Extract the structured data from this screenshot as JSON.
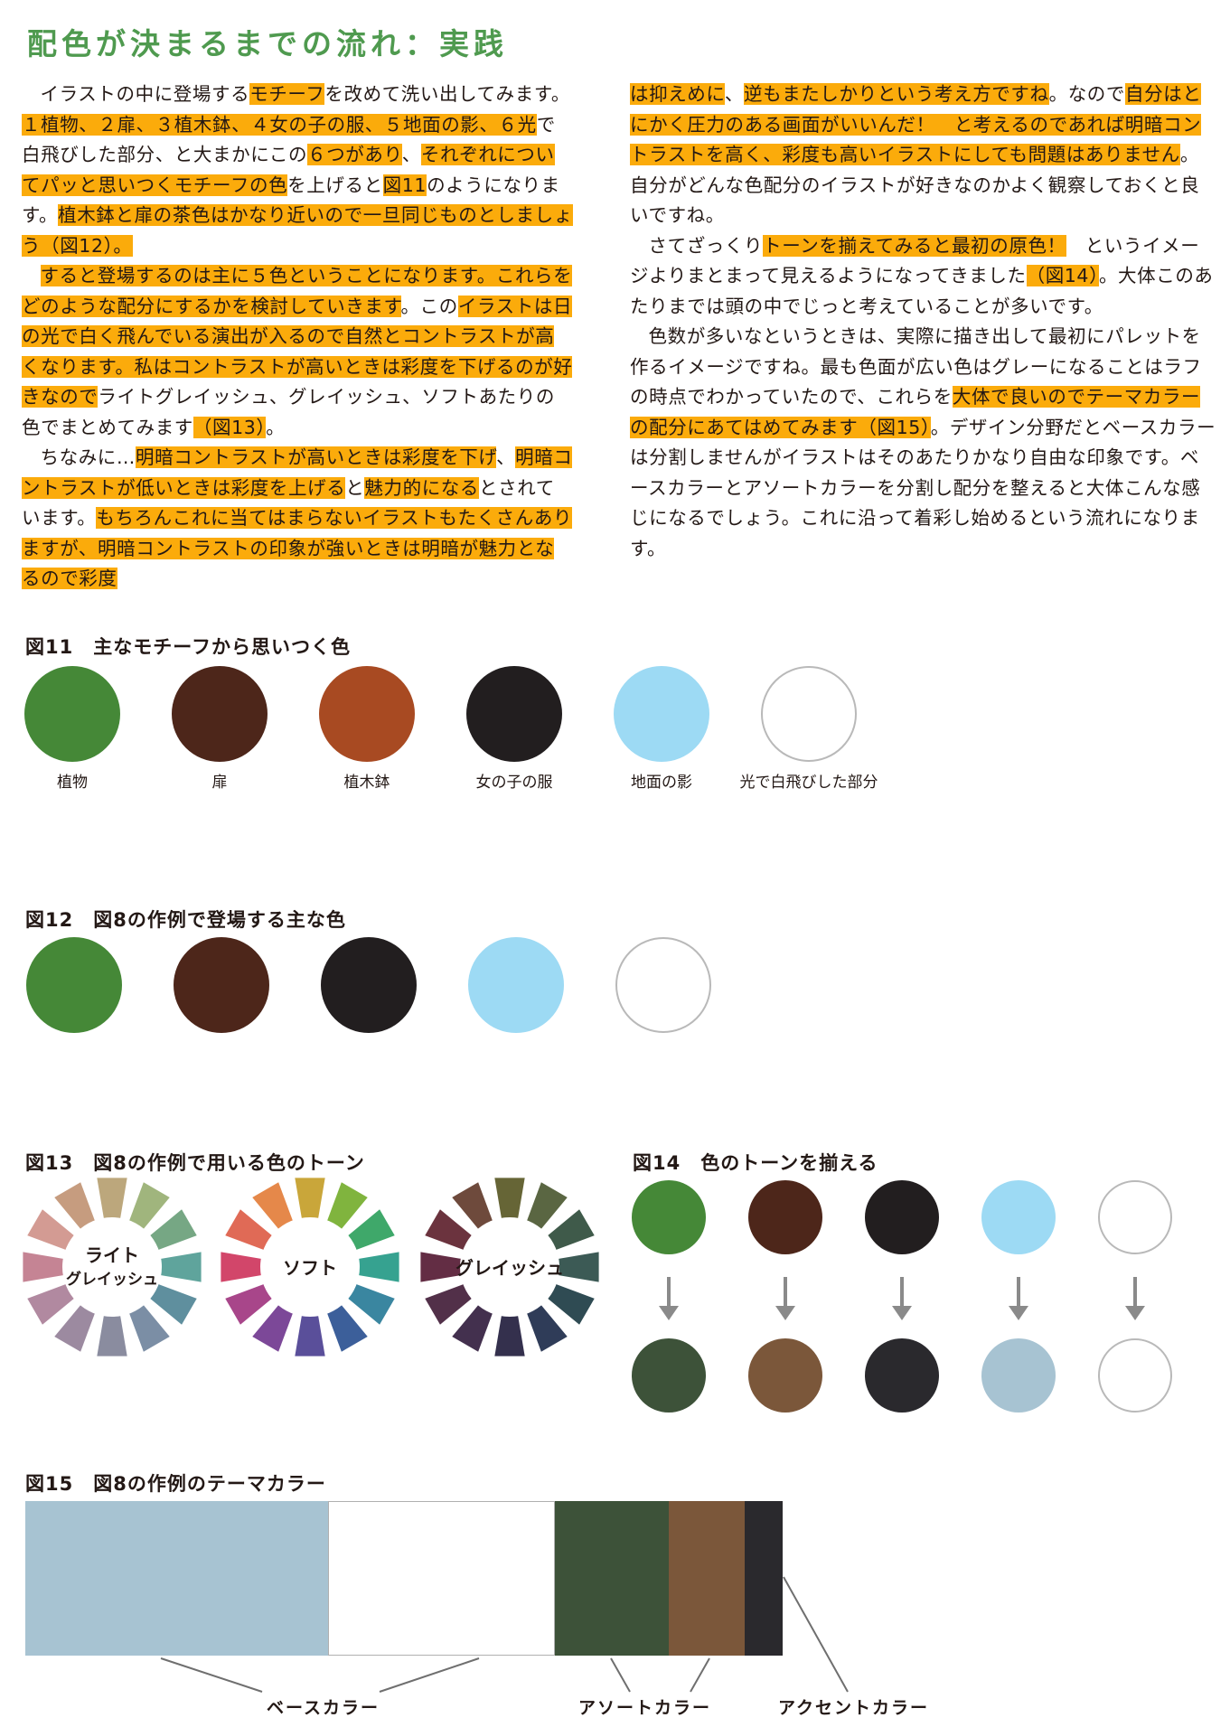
{
  "title": "配色が決まるまでの流れ：実践",
  "left_paragraphs": [
    [
      {
        "t": "イラストの中に登場する",
        "hl": false
      },
      {
        "t": "モチーフ",
        "hl": true
      },
      {
        "t": "を改めて洗い出してみます。",
        "hl": false
      },
      {
        "t": "１植物、２扉、３植木鉢、４女の子の服、５地面の影、６光",
        "hl": true
      },
      {
        "t": "で白飛びした部分、と大まかにこの",
        "hl": false
      },
      {
        "t": "６つがあり",
        "hl": true
      },
      {
        "t": "、",
        "hl": false
      },
      {
        "t": "それぞれについてパッと思いつくモチーフの色",
        "hl": true
      },
      {
        "t": "を上げると",
        "hl": false
      },
      {
        "t": "図11",
        "hl": true
      },
      {
        "t": "のようになります。",
        "hl": false
      },
      {
        "t": "植木鉢と扉の茶色はかなり近いので一旦同じものとしましょう（図12）。",
        "hl": true
      }
    ],
    [
      {
        "t": "すると登場するのは主に５色ということになります。これらをどのような配分にするかを検討していきます",
        "hl": true
      },
      {
        "t": "。この",
        "hl": false
      },
      {
        "t": "イラストは日の光で白く飛んでいる演出が入るので自然とコントラストが高くなります。私はコントラストが高いときは彩度を下げるのが好きなので",
        "hl": true
      },
      {
        "t": "ライトグレイッシュ、グレイッシュ、ソフトあたりの色でまとめてみます",
        "hl": false
      },
      {
        "t": "（図13）",
        "hl": true
      },
      {
        "t": "。",
        "hl": false
      }
    ],
    [
      {
        "t": "ちなみに…",
        "hl": false
      },
      {
        "t": "明暗コントラストが高いときは彩度を下げ",
        "hl": true
      },
      {
        "t": "、",
        "hl": false
      },
      {
        "t": "明暗コントラストが低いときは彩度を上げる",
        "hl": true
      },
      {
        "t": "と",
        "hl": false
      },
      {
        "t": "魅力的になる",
        "hl": true
      },
      {
        "t": "とされています。",
        "hl": false
      },
      {
        "t": "もちろんこれに当てはまらないイラストもたくさんありますが、明暗コントラストの印象が強いときは明暗が魅力となるので彩度",
        "hl": true
      }
    ]
  ],
  "right_paragraphs": [
    [
      {
        "t": "は抑えめに",
        "hl": true
      },
      {
        "t": "、",
        "hl": false
      },
      {
        "t": "逆もまたしかりという考え方ですね",
        "hl": true
      },
      {
        "t": "。なので",
        "hl": false
      },
      {
        "t": "自分はとにかく圧力のある画面がいいんだ！　と考えるのであれば明暗コントラストを高く、彩度も高いイラストにしても問題はありません",
        "hl": true
      },
      {
        "t": "。自分がどんな色配分のイラストが好きなのかよく観察しておくと良いですね。",
        "hl": false
      }
    ],
    [
      {
        "t": "さてざっくり",
        "hl": false
      },
      {
        "t": "トーンを揃えてみると最初の原色！",
        "hl": true
      },
      {
        "t": "　というイメージよりまとまって見えるようになってきました",
        "hl": false
      },
      {
        "t": "（図14）",
        "hl": true
      },
      {
        "t": "。大体このあたりまでは頭の中でじっと考えていることが多いです。",
        "hl": false
      }
    ],
    [
      {
        "t": "色数が多いなというときは、実際に描き出して最初にパレットを作るイメージですね。最も色面が広い色はグレーになることはラフの時点でわかっていたので、これらを",
        "hl": false
      },
      {
        "t": "大体で良いのでテーマカラーの配分にあてはめてみます（図15）",
        "hl": true
      },
      {
        "t": "。デザイン分野だとベースカラーは分割しませんがイラストはそのあたりかなり自由な印象です。ベースカラーとアソートカラーを分割し配分を整えると大体こんな感じになるでしょう。これに沿って着彩し始めるという流れになります。",
        "hl": false
      }
    ]
  ],
  "fig11": {
    "title": "図11　主なモチーフから思いつく色",
    "swatches": [
      {
        "label": "植物",
        "color": "#458837"
      },
      {
        "label": "扉",
        "color": "#4d261a"
      },
      {
        "label": "植木鉢",
        "color": "#a84a22"
      },
      {
        "label": "女の子の服",
        "color": "#221e1f"
      },
      {
        "label": "地面の影",
        "color": "#9ddaf4"
      },
      {
        "label": "光で白飛びした部分",
        "color": "#ffffff"
      }
    ]
  },
  "fig12": {
    "title": "図12　図8の作例で登場する主な色",
    "colors": [
      "#458837",
      "#4d261a",
      "#221e1f",
      "#9ddaf4",
      "#ffffff"
    ]
  },
  "fig13": {
    "title": "図13　図8の作例で用いる色のトーン",
    "wheels": [
      {
        "label_lines": [
          "ライト",
          "グレイッシュ"
        ],
        "colors": [
          "#bca77c",
          "#a0b57d",
          "#76a784",
          "#5fa49c",
          "#5f8f9e",
          "#7b8ea5",
          "#8a8c9f",
          "#9c8aa0",
          "#b189a0",
          "#c58494",
          "#d39b93",
          "#c69c7f"
        ]
      },
      {
        "label_lines": [
          "ソフト"
        ],
        "colors": [
          "#c9a63a",
          "#80b43e",
          "#3fa86a",
          "#36a290",
          "#3a86a0",
          "#3c5f9a",
          "#5a4f9a",
          "#7c4898",
          "#a8468a",
          "#d2466a",
          "#e06a56",
          "#e5884a"
        ]
      },
      {
        "label_lines": [
          "グレイッシュ"
        ],
        "colors": [
          "#666536",
          "#5a6642",
          "#3f5a4a",
          "#3c5a55",
          "#2f4b53",
          "#2f3c58",
          "#34304d",
          "#43304e",
          "#523049",
          "#632d44",
          "#6b333e",
          "#6e4a3c"
        ]
      }
    ]
  },
  "fig14": {
    "title": "図14　色のトーンを揃える",
    "top": [
      "#458837",
      "#4d261a",
      "#221e1f",
      "#9ddaf4",
      "#ffffff"
    ],
    "bottom": [
      "#3d5239",
      "#7b573a",
      "#2a292d",
      "#a7c3d2",
      "#ffffff"
    ]
  },
  "fig15": {
    "title": "図15　図8の作例のテーマカラー",
    "segments": [
      {
        "color": "#a7c3d2",
        "share": 40
      },
      {
        "color": "#ffffff",
        "share": 30
      },
      {
        "color": "#3d5239",
        "share": 15
      },
      {
        "color": "#7b573a",
        "share": 10
      },
      {
        "color": "#2a292d",
        "share": 5
      }
    ],
    "labels": {
      "base": "ベースカラー",
      "assort": "アソートカラー",
      "accent": "アクセントカラー"
    }
  }
}
